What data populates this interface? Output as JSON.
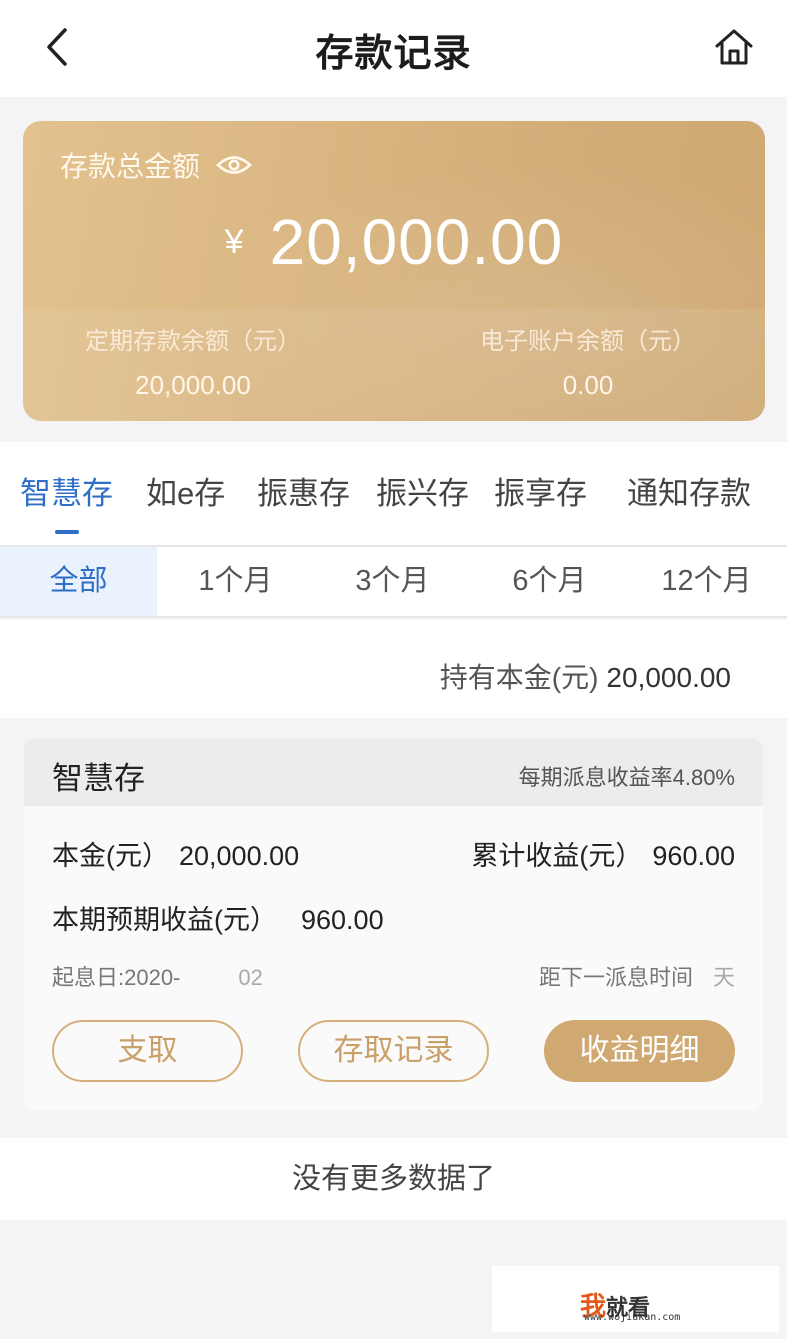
{
  "header": {
    "title": "存款记录",
    "back_icon": "chevron-left-icon",
    "home_icon": "home-icon"
  },
  "summary": {
    "total_label": "存款总金额",
    "currency_symbol": "¥",
    "total_amount": "20,000.00",
    "fixed_label": "定期存款余额（元）",
    "fixed_value": "20,000.00",
    "ecard_label": "电子账户余额（元）",
    "ecard_value": "0.00",
    "card_color": "#d8b47f"
  },
  "product_tabs": [
    {
      "label": "智慧存",
      "active": true
    },
    {
      "label": "如e存",
      "active": false
    },
    {
      "label": "振惠存",
      "active": false
    },
    {
      "label": "振兴存",
      "active": false
    },
    {
      "label": "振享存",
      "active": false
    },
    {
      "label": "通知存款",
      "active": false
    }
  ],
  "periods": [
    {
      "label": "全部",
      "active": true
    },
    {
      "label": "1个月",
      "active": false
    },
    {
      "label": "3个月",
      "active": false
    },
    {
      "label": "6个月",
      "active": false
    },
    {
      "label": "12个月",
      "active": false
    }
  ],
  "principal": {
    "label": "持有本金(元)",
    "value": "20,000.00"
  },
  "deposit": {
    "name": "智慧存",
    "rate_text": "每期派息收益率4.80%",
    "principal_label": "本金(元）",
    "principal_value": "20,000.00",
    "cumulative_label": "累计收益(元）",
    "cumulative_value": "960.00",
    "expected_label": "本期预期收益(元）",
    "expected_value": "960.00",
    "start_date_text": "起息日:2020-",
    "start_date_tail": "02",
    "next_payout_text": "距下一派息时间",
    "next_payout_unit": "天",
    "buttons": {
      "withdraw": "支取",
      "records": "存取记录",
      "earnings": "收益明细"
    }
  },
  "footer": {
    "no_more": "没有更多数据了"
  },
  "watermark": {
    "brand_char": "我",
    "brand_rest": "就看",
    "url": "www.wojiukan.com"
  },
  "colors": {
    "accent_blue": "#2f6fc8",
    "gold": "#cfa872"
  }
}
